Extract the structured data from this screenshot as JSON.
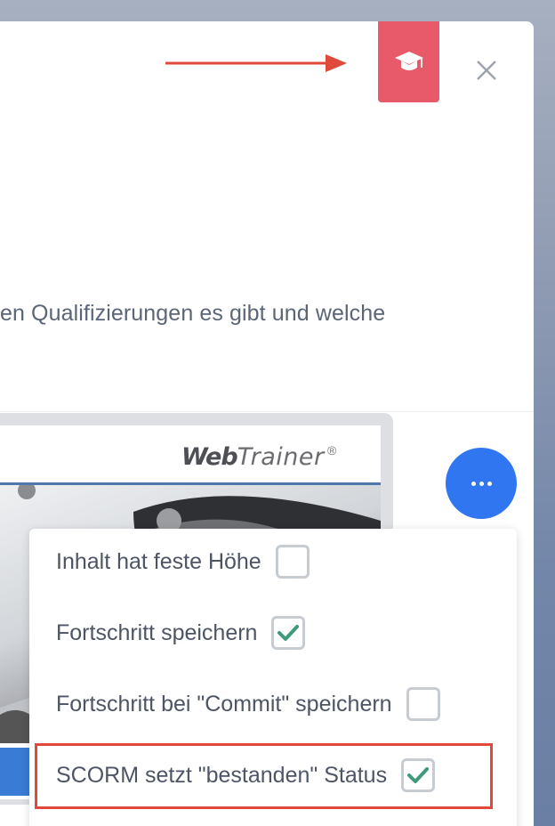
{
  "description_text": "en Qualifizierungen es gibt und welche",
  "header": {
    "qualification_icon": "graduation-cap-icon",
    "close_icon": "close-icon",
    "accent_color": "#e85a6a",
    "annotation_arrow_color": "#e04a3a"
  },
  "preview": {
    "logo_bold": "Web",
    "logo_light": "Trainer",
    "logo_registered": "®"
  },
  "more_button": {
    "icon": "more-horizontal-icon",
    "color": "#2f76f0"
  },
  "menu": {
    "items": [
      {
        "label": "Inhalt hat feste Höhe",
        "checked": false
      },
      {
        "label": "Fortschritt speichern",
        "checked": true
      },
      {
        "label": "Fortschritt bei \"Commit\" speichern",
        "checked": false
      },
      {
        "label": "SCORM setzt \"bestanden\" Status",
        "checked": true,
        "highlighted": true
      }
    ],
    "check_color": "#3f9a7c",
    "highlight_color": "#e04a3a"
  }
}
